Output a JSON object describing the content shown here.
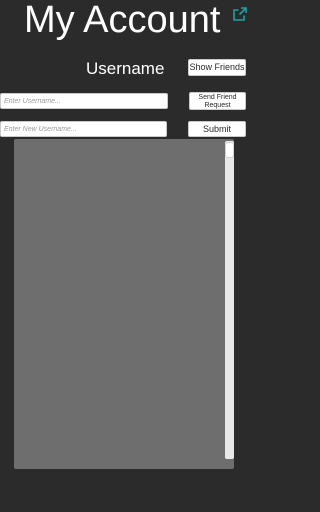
{
  "header": {
    "title": "My Account",
    "external_icon": "external-link-icon",
    "icon_color": "#1aa3a3"
  },
  "profile": {
    "username_label": "Username",
    "show_friends_label": "Show Friends"
  },
  "friend_request": {
    "username_placeholder": "Enter Username...",
    "send_label": "Send Friend Request"
  },
  "change_username": {
    "new_username_placeholder": "Enter New Username...",
    "submit_label": "Submit"
  },
  "friends_list": {
    "background_color": "#6e6e6e",
    "scroll_position": 0
  },
  "colors": {
    "background": "#2b2b2b",
    "accent": "#1aa3a3"
  }
}
